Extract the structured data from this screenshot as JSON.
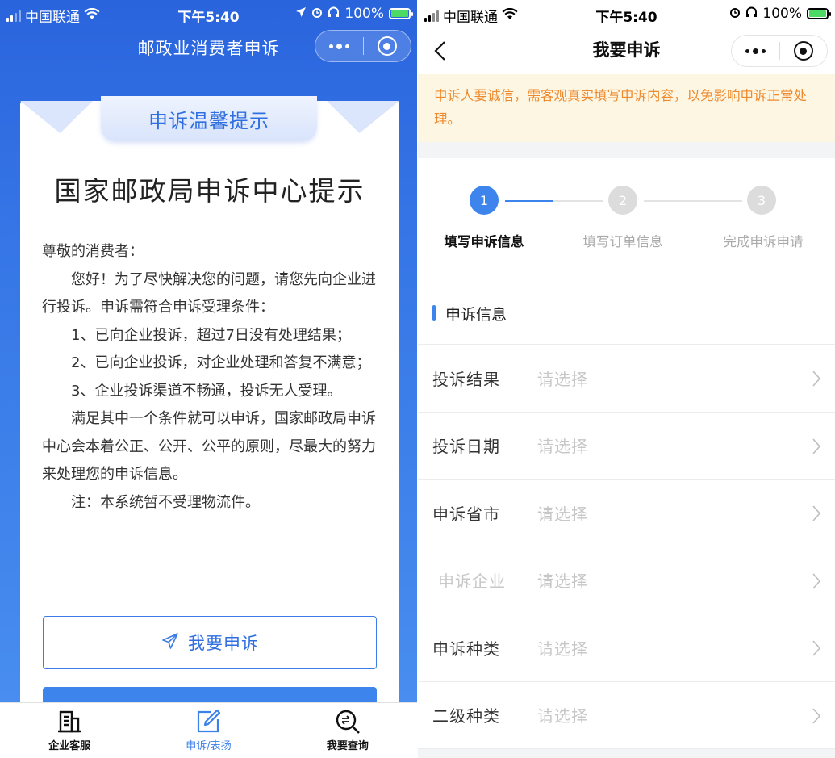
{
  "status_bar": {
    "carrier": "中国联通",
    "time": "下午5:40",
    "battery": "100%"
  },
  "left": {
    "nav_title": "邮政业消费者申诉",
    "ribbon_title": "申诉温馨提示",
    "card_title": "国家邮政局申诉中心提示",
    "paragraphs": [
      "尊敬的消费者：",
      "您好！为了尽快解决您的问题，请您先向企业进行投诉。申诉需符合申诉受理条件：",
      "1、已向企业投诉，超过7日没有处理结果；",
      "2、已向企业投诉，对企业处理和答复不满意；",
      "3、企业投诉渠道不畅通，投诉无人受理。",
      "满足其中一个条件就可以申诉，国家邮政局申诉中心会本着公正、公开、公平的原则，尽最大的努力来处理您的申诉信息。",
      "注：本系统暂不受理物流件。"
    ],
    "complain_button": "我要申诉",
    "tabbar": [
      {
        "label": "企业客服",
        "icon": "building-icon"
      },
      {
        "label": "申诉/表扬",
        "icon": "edit-icon"
      },
      {
        "label": "我要查询",
        "icon": "search-icon"
      }
    ]
  },
  "right": {
    "nav_title": "我要申诉",
    "warning": "申诉人要诚信，需客观真实填写申诉内容，以免影响申诉正常处理。",
    "steps": [
      {
        "num": "1",
        "label": "填写申诉信息"
      },
      {
        "num": "2",
        "label": "填写订单信息"
      },
      {
        "num": "3",
        "label": "完成申诉申请"
      }
    ],
    "section_title": "申诉信息",
    "placeholder": "请选择",
    "fields": [
      "投诉结果",
      "投诉日期",
      "申诉省市",
      "申诉企业",
      "申诉种类",
      "二级种类"
    ]
  },
  "colors": {
    "primary": "#3d85ec",
    "warning": "#ee8a2e",
    "header_blue": "#2a64dd"
  }
}
